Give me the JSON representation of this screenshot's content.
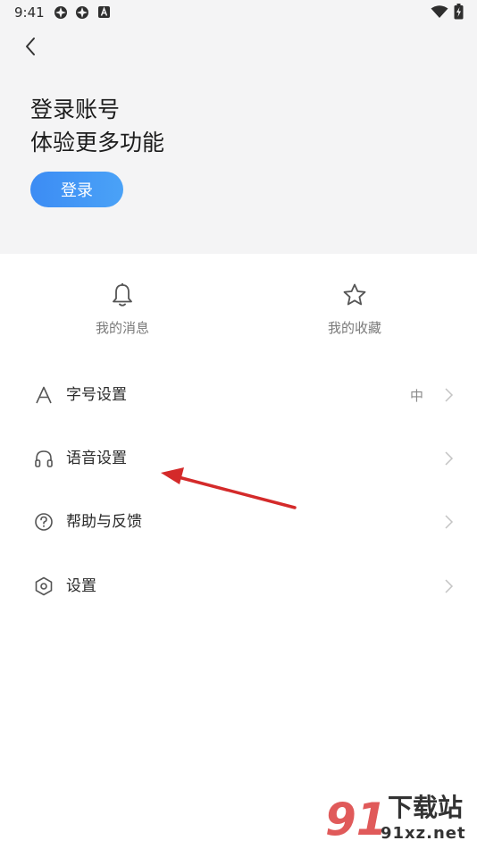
{
  "status_bar": {
    "time": "9:41",
    "icons": [
      "app-notification-icon",
      "app-notification-icon",
      "a-badge-icon",
      "wifi-icon",
      "battery-charging-icon"
    ]
  },
  "header": {
    "login_title_line1": "登录账号",
    "login_title_line2": "体验更多功能",
    "login_button": "登录"
  },
  "quick_actions": [
    {
      "label": "我的消息",
      "icon": "bell-icon"
    },
    {
      "label": "我的收藏",
      "icon": "star-icon"
    }
  ],
  "menu": [
    {
      "label": "字号设置",
      "icon": "font-size-icon",
      "value": "中"
    },
    {
      "label": "语音设置",
      "icon": "headphones-icon",
      "value": ""
    },
    {
      "label": "帮助与反馈",
      "icon": "help-icon",
      "value": ""
    },
    {
      "label": "设置",
      "icon": "settings-hexagon-icon",
      "value": ""
    }
  ],
  "watermark": {
    "mark": "91",
    "title": "下载站",
    "url": "91xz.net"
  },
  "colors": {
    "accent": "#3c8cf4",
    "header_bg": "#f4f4f5",
    "annotation_arrow": "#d42a2a"
  }
}
